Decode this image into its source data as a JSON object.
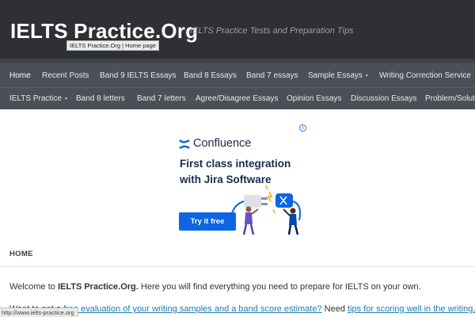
{
  "header": {
    "site_title": "IELTS Practice.Org",
    "tagline": "IELTS Practice Tests and Preparation Tips",
    "tooltip": "IELTS Practice.Org | Home page"
  },
  "nav": {
    "row1": [
      {
        "label": "Home",
        "active": true
      },
      {
        "label": "Recent Posts"
      },
      {
        "label": "Band 9 IELTS Essays"
      },
      {
        "label": "Band 8 Essays"
      },
      {
        "label": "Band 7 essays"
      },
      {
        "label": "Sample Essays",
        "dropdown": true
      },
      {
        "label": "Writing Correction Service"
      }
    ],
    "row2": [
      {
        "label": "IELTS Practice",
        "dropdown": true
      },
      {
        "label": "Band 8 letters"
      },
      {
        "label": "Band 7 letters"
      },
      {
        "label": "Agree/Disagree Essays"
      },
      {
        "label": "Opinion Essays"
      },
      {
        "label": "Discussion Essays"
      },
      {
        "label": "Problem/Soluti"
      }
    ],
    "caret": "▾"
  },
  "ad": {
    "info_icon": "i",
    "brand": "Confluence",
    "headline": "First class integration with Jira Software",
    "cta": "Try it free",
    "accent": "#0c66e4"
  },
  "content": {
    "breadcrumb": "HOME",
    "welcome_pre": "Welcome to ",
    "welcome_bold": "IELTS Practice.Org.",
    "welcome_post": " Here you will find everything you need to prepare for IELTS on your own.",
    "line2_pre": "Want to get a ",
    "line2_link1": "free evaluation of your writing samples and a band score estimate?",
    "line2_mid": " Need ",
    "line2_link2": "tips for scoring well in the writing,"
  },
  "status_bar": "http://www.ielts-practice.org"
}
